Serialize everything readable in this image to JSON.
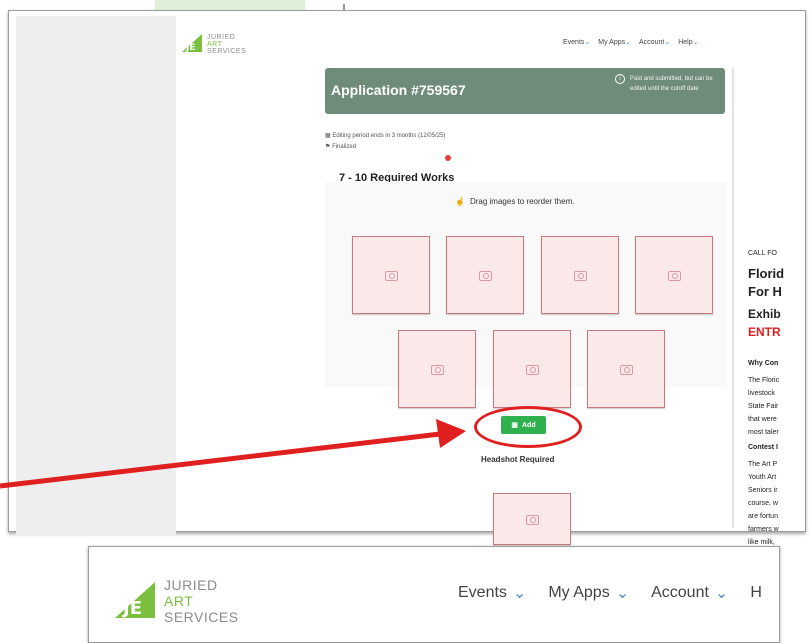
{
  "brand": {
    "line1": "JURIED",
    "line2": "ART",
    "line3": "SERVICES",
    "green": "#7cbf3f",
    "gray": "#8c8c8c"
  },
  "nav": {
    "items": [
      {
        "label": "Events"
      },
      {
        "label": "My Apps"
      },
      {
        "label": "Account"
      },
      {
        "label": "Help"
      }
    ],
    "chevron_icon": "chevron-down-icon"
  },
  "application": {
    "title": "Application #759567",
    "status_note": "Paid and submitted, but can be edited until the cutoff date",
    "info_icon": "info-icon",
    "header_color": "#6f8c7a",
    "editing_period": "Editing period ends in 3 months (12/05/25)",
    "state": "Finalized"
  },
  "works": {
    "title": "7 - 10 Required Works",
    "drag_hint": "Drag images to reorder them.",
    "thumb_icon": "camera-icon",
    "thumb_count": 7,
    "add_label": "Add",
    "add_color": "#2fb14f",
    "highlight_color": "#e01f1f"
  },
  "headshot": {
    "title": "Headshot Required"
  },
  "right_panel": {
    "call": "CALL FO",
    "title1": "Florid",
    "title2": "For H",
    "exhibit": "Exhib",
    "entry": "ENTR",
    "why": "Why Con",
    "lines": [
      "The Floric",
      "livestock",
      "State Fair",
      "that were",
      "most taler"
    ],
    "contest": "Contest I",
    "lines2": [
      "The Art P",
      "Youth Art",
      "Seniors ir",
      "course, w",
      "are fortun",
      "farmers w",
      "like milk,"
    ]
  },
  "bottom_nav": {
    "items": [
      {
        "label": "Events"
      },
      {
        "label": "My Apps"
      },
      {
        "label": "Account"
      },
      {
        "label": "H"
      }
    ]
  }
}
